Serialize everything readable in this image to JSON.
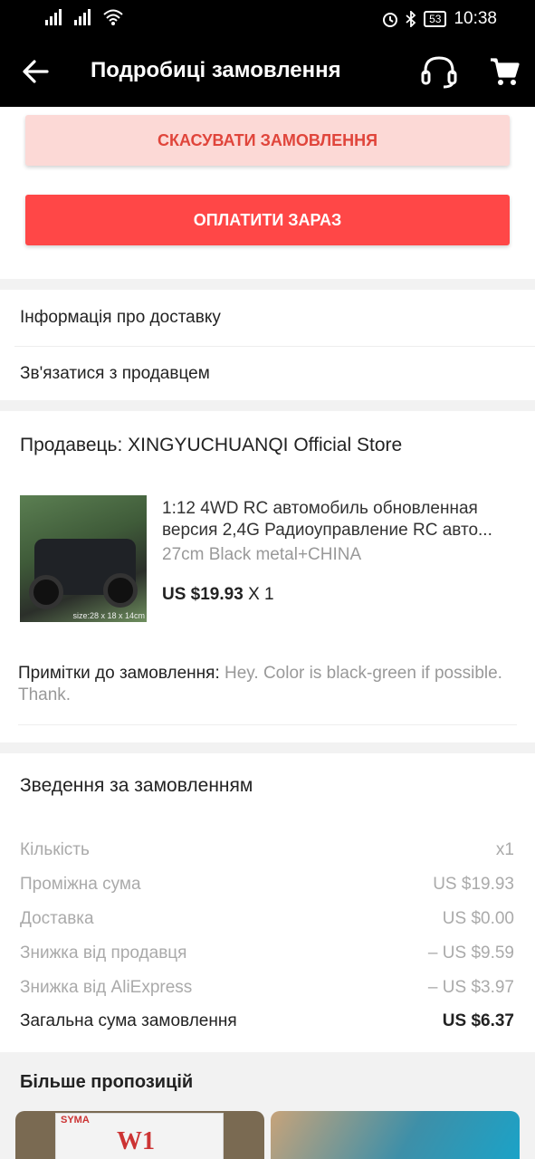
{
  "status_bar": {
    "battery": "53",
    "time": "10:38"
  },
  "app_bar": {
    "title": "Подробиці замовлення"
  },
  "actions": {
    "cancel": "СКАСУВАТИ ЗАМОВЛЕННЯ",
    "pay": "ОПЛАТИТИ ЗАРАЗ"
  },
  "info": {
    "delivery": "Інформація про доставку",
    "contact": "Зв'язатися з продавцем"
  },
  "seller": {
    "name": "Продавець: XINGYUCHUANQI Official Store",
    "product": {
      "title_line1": "1:12 4WD RC автомобиль обновленная",
      "title_line2": "версия 2,4G Радиоуправление RC авто...",
      "variant": "27cm Black metal+CHINA",
      "price": "US $19.93",
      "qty": "X 1",
      "image_caption": "size:28 x 18 x 14cm"
    },
    "notes_label": "Примітки до замовлення:",
    "notes_value": "Hey. Color is black-green if possible. Thank."
  },
  "summary": {
    "title": "Зведення за замовленням",
    "rows": [
      {
        "label": "Кількість",
        "value": "x1"
      },
      {
        "label": "Проміжна сума",
        "value": "US $19.93"
      },
      {
        "label": "Доставка",
        "value": "US $0.00"
      },
      {
        "label": "Знижка від продавця",
        "value": "– US $9.59"
      },
      {
        "label": "Знижка від AliExpress",
        "value": "– US $3.97"
      }
    ],
    "total_label": "Загальна сума замовлення",
    "total_value": "US $6.37"
  },
  "more": {
    "title": "Більше пропозицій",
    "rec1_brand": "SYMA",
    "rec1_model": "W1"
  },
  "colors": {
    "accent": "#ff4747",
    "cancel_bg": "#fcd9d6",
    "cancel_text": "#e0453b"
  }
}
